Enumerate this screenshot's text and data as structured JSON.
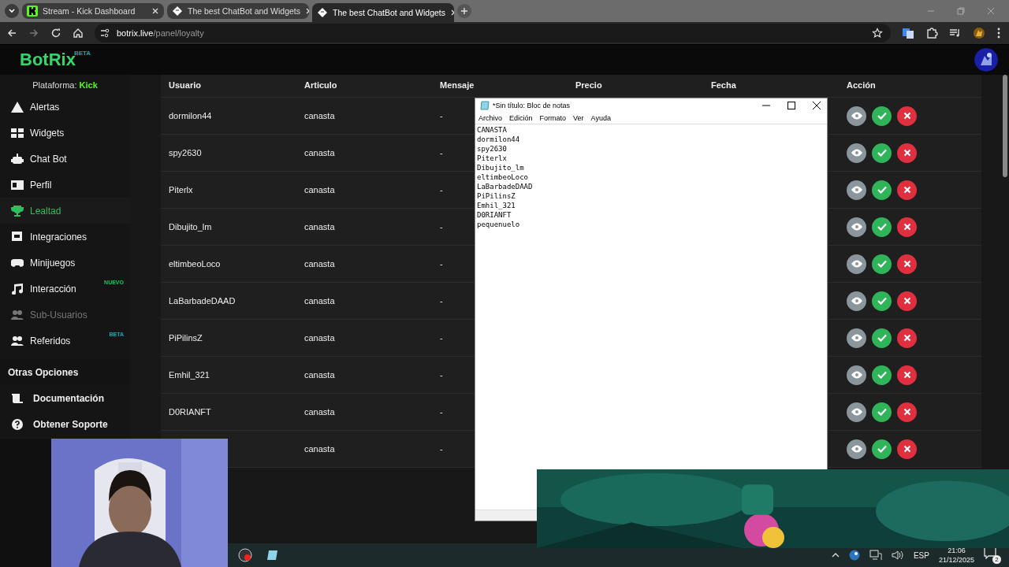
{
  "browser": {
    "tabs": [
      {
        "title": "Stream - Kick Dashboard",
        "selected": false
      },
      {
        "title": "The best ChatBot and Widgets",
        "selected": false
      },
      {
        "title": "The best ChatBot and Widgets",
        "selected": true
      }
    ],
    "url_host": "botrix.live",
    "url_path": "/panel/loyalty"
  },
  "app": {
    "logo": "BotRix",
    "logo_badge": "BETA",
    "platform_label": "Plataforma:",
    "platform": "Kick",
    "nav": [
      {
        "label": "Alertas",
        "selected": false,
        "disabled": false
      },
      {
        "label": "Widgets",
        "selected": false,
        "disabled": false
      },
      {
        "label": "Chat Bot",
        "selected": false,
        "disabled": false
      },
      {
        "label": "Perfil",
        "selected": false,
        "disabled": false
      },
      {
        "label": "Lealtad",
        "selected": true,
        "disabled": false
      },
      {
        "label": "Integraciones",
        "selected": false,
        "disabled": false
      },
      {
        "label": "Minijuegos",
        "selected": false,
        "disabled": false
      },
      {
        "label": "Interacción",
        "selected": false,
        "disabled": false,
        "badge": "NUEVO",
        "color": "#22c55e"
      },
      {
        "label": "Sub-Usuarios",
        "selected": false,
        "disabled": true
      },
      {
        "label": "Referidos",
        "selected": false,
        "disabled": false,
        "badge": "BETA",
        "color": "#1fa2b8"
      }
    ],
    "section_title": "Otras Opciones",
    "extra": [
      {
        "label": "Documentación"
      },
      {
        "label": "Obtener Soporte"
      }
    ]
  },
  "table": {
    "columns": [
      "Usuario",
      "Articulo",
      "Mensaje",
      "Precio",
      "Fecha",
      "Acción"
    ],
    "rows": [
      {
        "user": "dormilon44",
        "item": "canasta",
        "message": "-"
      },
      {
        "user": "spy2630",
        "item": "canasta",
        "message": "-"
      },
      {
        "user": "Piterlx",
        "item": "canasta",
        "message": "-"
      },
      {
        "user": "Dibujito_lm",
        "item": "canasta",
        "message": "-"
      },
      {
        "user": "eltimbeoLoco",
        "item": "canasta",
        "message": "-"
      },
      {
        "user": "LaBarbadeDAAD",
        "item": "canasta",
        "message": "-"
      },
      {
        "user": "PiPilinsZ",
        "item": "canasta",
        "message": "-"
      },
      {
        "user": "Emhil_321",
        "item": "canasta",
        "message": "-"
      },
      {
        "user": "D0RIANFT",
        "item": "canasta",
        "message": "-"
      },
      {
        "item": "canasta",
        "message": "-"
      }
    ]
  },
  "notepad": {
    "title": "*Sin título: Bloc de notas",
    "menu": [
      "Archivo",
      "Edición",
      "Formato",
      "Ver",
      "Ayuda"
    ],
    "lines": [
      "CANASTA",
      "dormilon44",
      "spy2630",
      "Piterlx",
      "Dibujito_lm",
      "eltimbeoLoco",
      "LaBarbadeDAAD",
      "PiPilinsZ",
      "Emhil_321",
      "D0RIANFT",
      "pequenuelo"
    ]
  },
  "taskbar": {
    "language": "ESP",
    "time": "21:06",
    "date": "21/12/2025",
    "notifications": "2"
  }
}
